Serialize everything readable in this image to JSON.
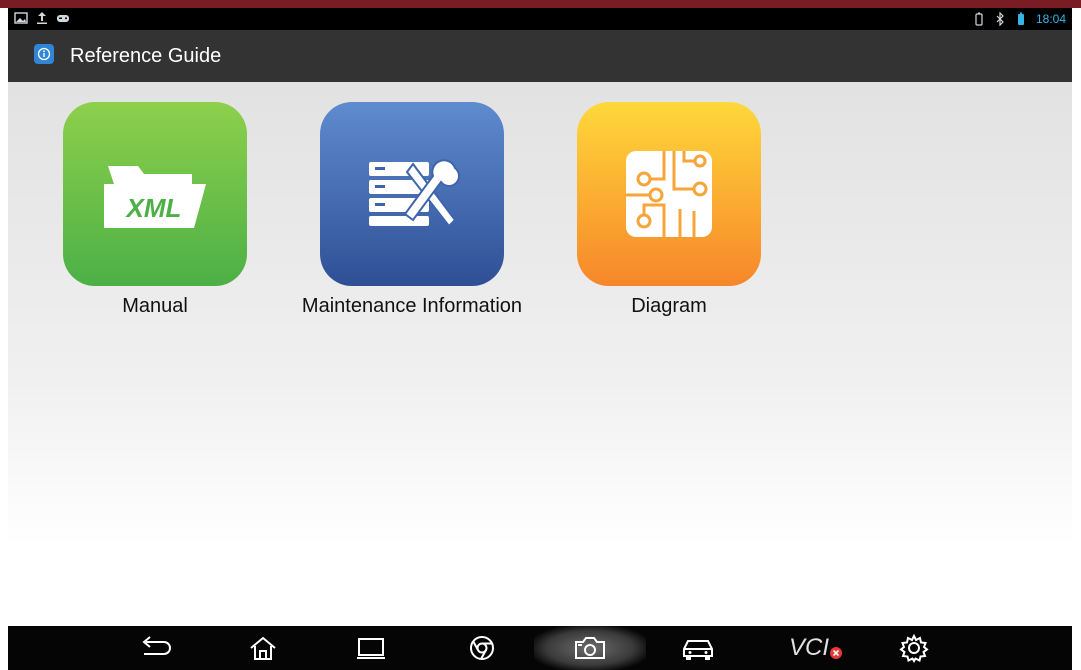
{
  "status_bar": {
    "time": "18:04",
    "time_color": "#33b5e5"
  },
  "title_bar": {
    "title": "Reference Guide",
    "app_icon": "reference-guide-icon"
  },
  "tiles": [
    {
      "label": "Manual",
      "icon": "xml-folder-icon",
      "color": "#4cb046",
      "icon_text": "XML"
    },
    {
      "label": "Maintenance Information",
      "icon": "server-tools-icon",
      "color": "#2f4f95"
    },
    {
      "label": "Diagram",
      "icon": "circuit-board-icon",
      "color": "#f7862a"
    }
  ],
  "nav_bar": {
    "buttons": [
      "back-icon",
      "home-icon",
      "recent-apps-icon",
      "browser-icon",
      "camera-icon",
      "car-icon",
      "vci-icon",
      "settings-icon"
    ],
    "vci_label": "VCI",
    "vci_status_color": "#e53935"
  }
}
